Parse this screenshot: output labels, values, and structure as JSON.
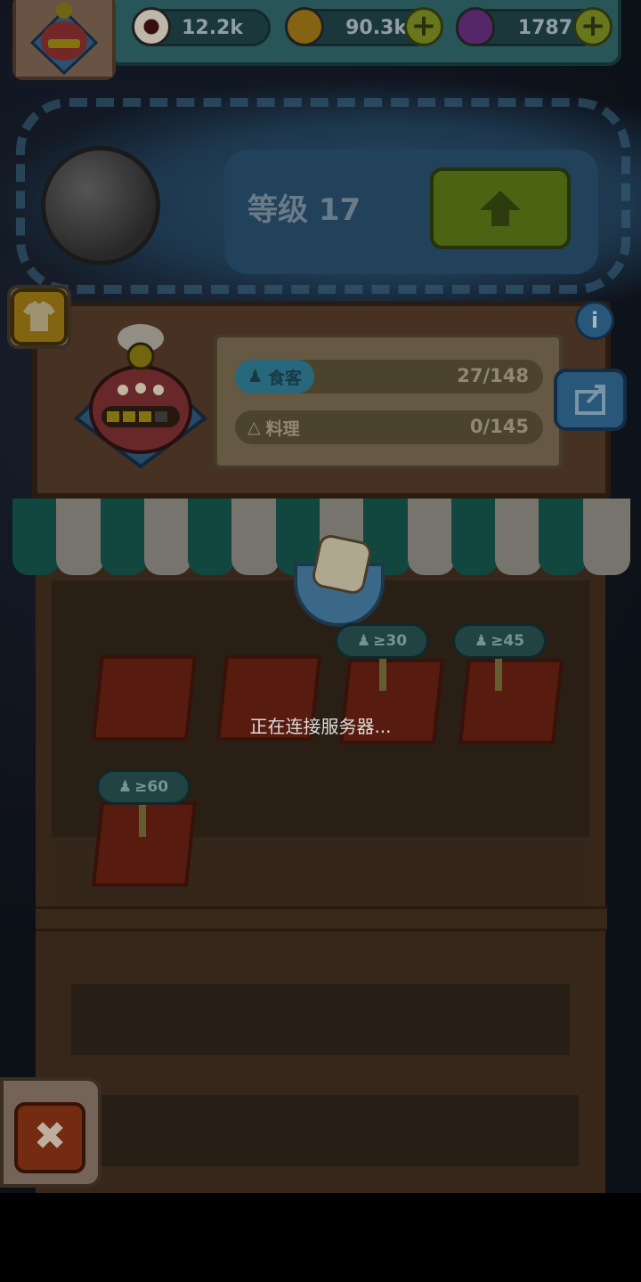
{
  "resources": {
    "eyes": "12.2k",
    "coins": "90.3k",
    "potions": "1787"
  },
  "level": {
    "label": "等级 17"
  },
  "stats": {
    "diners_label": "食客",
    "diners_value": "27/148",
    "dishes_label": "料理",
    "dishes_value": "0/145"
  },
  "tables": [
    {
      "requirement": ""
    },
    {
      "requirement": ""
    },
    {
      "requirement": "≥30"
    },
    {
      "requirement": "≥45"
    },
    {
      "requirement": "≥60"
    }
  ],
  "loading": {
    "message": "正在连接服务器..."
  },
  "colors": {
    "diners_tag": "#2b7f96",
    "awning_green": "#124b43",
    "awning_white": "#7d7b73",
    "upgrade_green": "#4f6a16"
  },
  "icons": {
    "eye": "eye-icon",
    "coin": "coin-icon",
    "potion": "potion-icon",
    "plus": "plus-icon",
    "up_arrow": "up-arrow-icon",
    "shirt": "shirt-icon",
    "info": "info-icon",
    "share": "share-icon",
    "close": "close-icon",
    "person": "person-icon",
    "dish": "dish-icon"
  }
}
